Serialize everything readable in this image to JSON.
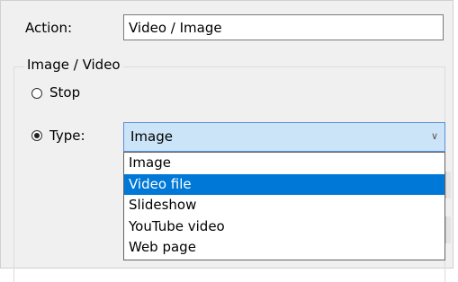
{
  "form": {
    "action_label": "Action:",
    "action_value": "Video / Image",
    "group_title": "Image / Video",
    "stop_label": "Stop",
    "type_label": "Type:",
    "stop_selected": false,
    "type_selected": true
  },
  "type_select": {
    "value": "Image",
    "options": [
      "Image",
      "Video file",
      "Slideshow",
      "YouTube video",
      "Web page"
    ],
    "highlighted": "Video file"
  },
  "icons": {
    "dropdown_chevron": "chevron-down-icon"
  },
  "colors": {
    "highlight": "#0078d7",
    "select_background": "#cce4f7",
    "select_border": "#5a8ed8"
  }
}
